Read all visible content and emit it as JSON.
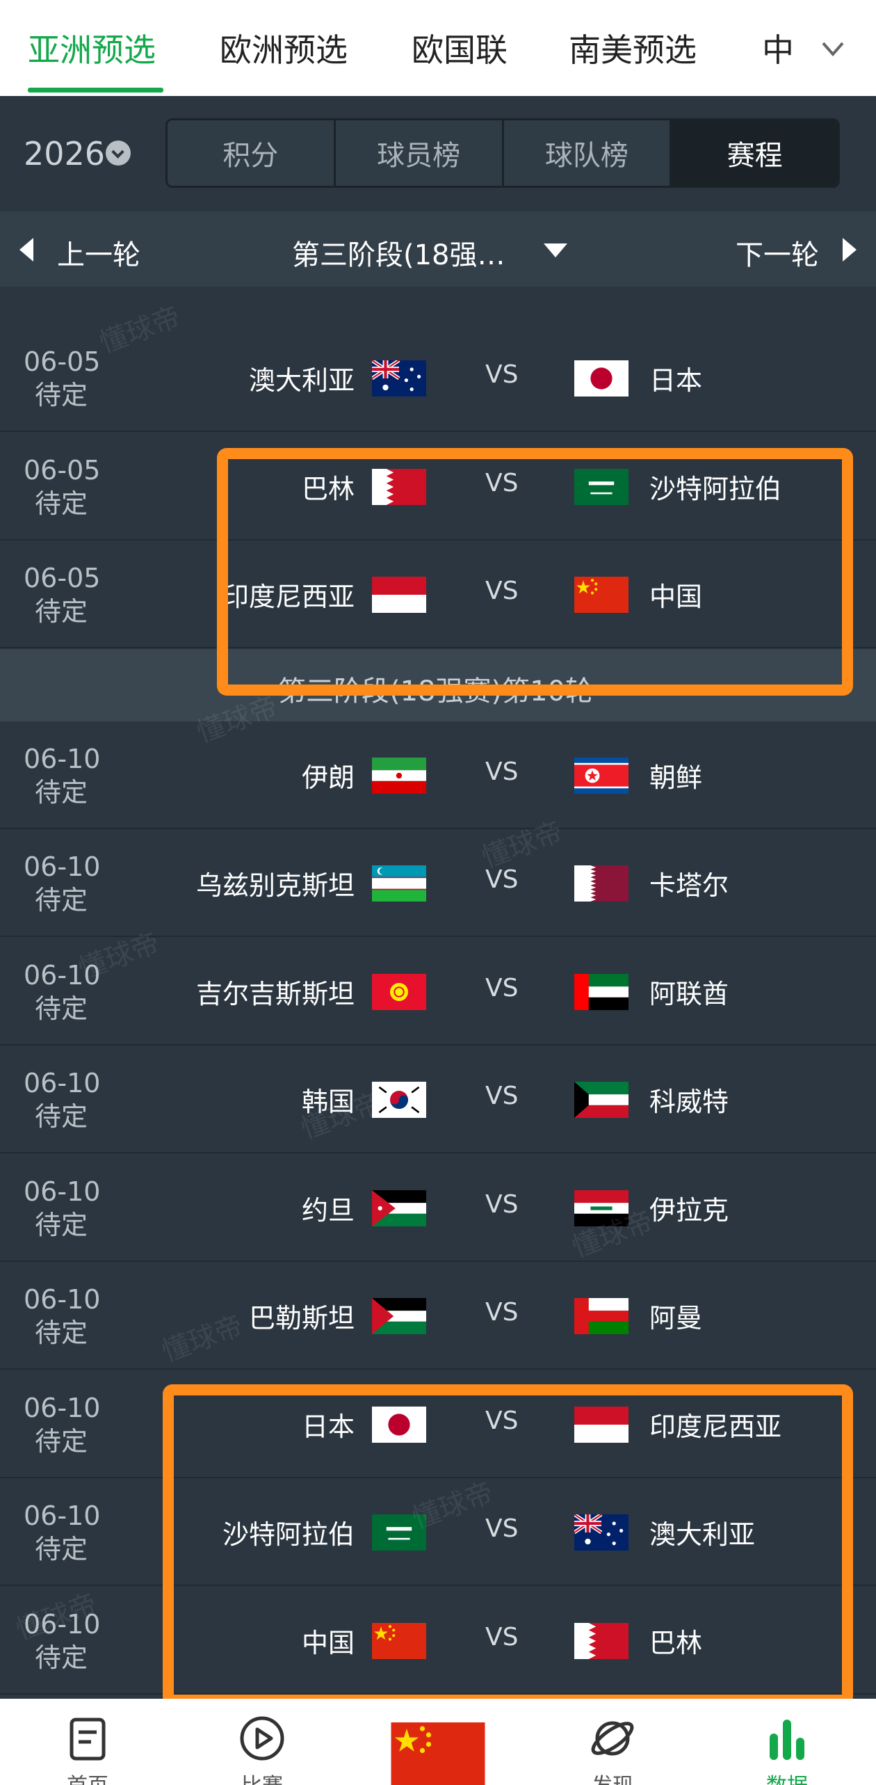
{
  "top_tabs": [
    "亚洲预选",
    "欧洲预选",
    "欧国联",
    "南美预选",
    "中"
  ],
  "season": {
    "year": "2026"
  },
  "segments": [
    "积分",
    "球员榜",
    "球队榜",
    "赛程"
  ],
  "round_nav": {
    "prev": "上一轮",
    "title": "第三阶段(18强…",
    "next": "下一轮"
  },
  "partial_top_status": "待定",
  "section_title": "第三阶段(18强赛)第10轮",
  "matches_round9": [
    {
      "date": "06-05",
      "status": "待定",
      "home": "澳大利亚",
      "home_flag": "australia",
      "vs": "VS",
      "away": "日本",
      "away_flag": "japan"
    },
    {
      "date": "06-05",
      "status": "待定",
      "home": "巴林",
      "home_flag": "bahrain",
      "vs": "VS",
      "away": "沙特阿拉伯",
      "away_flag": "saudi"
    },
    {
      "date": "06-05",
      "status": "待定",
      "home": "印度尼西亚",
      "home_flag": "indonesia",
      "vs": "VS",
      "away": "中国",
      "away_flag": "china"
    }
  ],
  "matches_round10": [
    {
      "date": "06-10",
      "status": "待定",
      "home": "伊朗",
      "home_flag": "iran",
      "vs": "VS",
      "away": "朝鲜",
      "away_flag": "north-korea"
    },
    {
      "date": "06-10",
      "status": "待定",
      "home": "乌兹别克斯坦",
      "home_flag": "uzbekistan",
      "vs": "VS",
      "away": "卡塔尔",
      "away_flag": "qatar"
    },
    {
      "date": "06-10",
      "status": "待定",
      "home": "吉尔吉斯斯坦",
      "home_flag": "kyrgyzstan",
      "vs": "VS",
      "away": "阿联酋",
      "away_flag": "uae"
    },
    {
      "date": "06-10",
      "status": "待定",
      "home": "韩国",
      "home_flag": "south-korea",
      "vs": "VS",
      "away": "科威特",
      "away_flag": "kuwait"
    },
    {
      "date": "06-10",
      "status": "待定",
      "home": "约旦",
      "home_flag": "jordan",
      "vs": "VS",
      "away": "伊拉克",
      "away_flag": "iraq"
    },
    {
      "date": "06-10",
      "status": "待定",
      "home": "巴勒斯坦",
      "home_flag": "palestine",
      "vs": "VS",
      "away": "阿曼",
      "away_flag": "oman"
    },
    {
      "date": "06-10",
      "status": "待定",
      "home": "日本",
      "home_flag": "japan",
      "vs": "VS",
      "away": "印度尼西亚",
      "away_flag": "indonesia"
    },
    {
      "date": "06-10",
      "status": "待定",
      "home": "沙特阿拉伯",
      "home_flag": "saudi",
      "vs": "VS",
      "away": "澳大利亚",
      "away_flag": "australia"
    },
    {
      "date": "06-10",
      "status": "待定",
      "home": "中国",
      "home_flag": "china",
      "vs": "VS",
      "away": "巴林",
      "away_flag": "bahrain"
    }
  ],
  "watermark": "懂球帝",
  "bottom_nav": [
    {
      "label": "首页",
      "icon": "document-icon"
    },
    {
      "label": "比赛",
      "icon": "play-icon"
    },
    {
      "label": "",
      "icon": "china-flag"
    },
    {
      "label": "发现",
      "icon": "planet-icon"
    },
    {
      "label": "数据",
      "icon": "bar-chart-icon"
    }
  ],
  "colors": {
    "accent": "#13a84a",
    "highlight": "#ff8c1a",
    "background": "#2b3640"
  }
}
